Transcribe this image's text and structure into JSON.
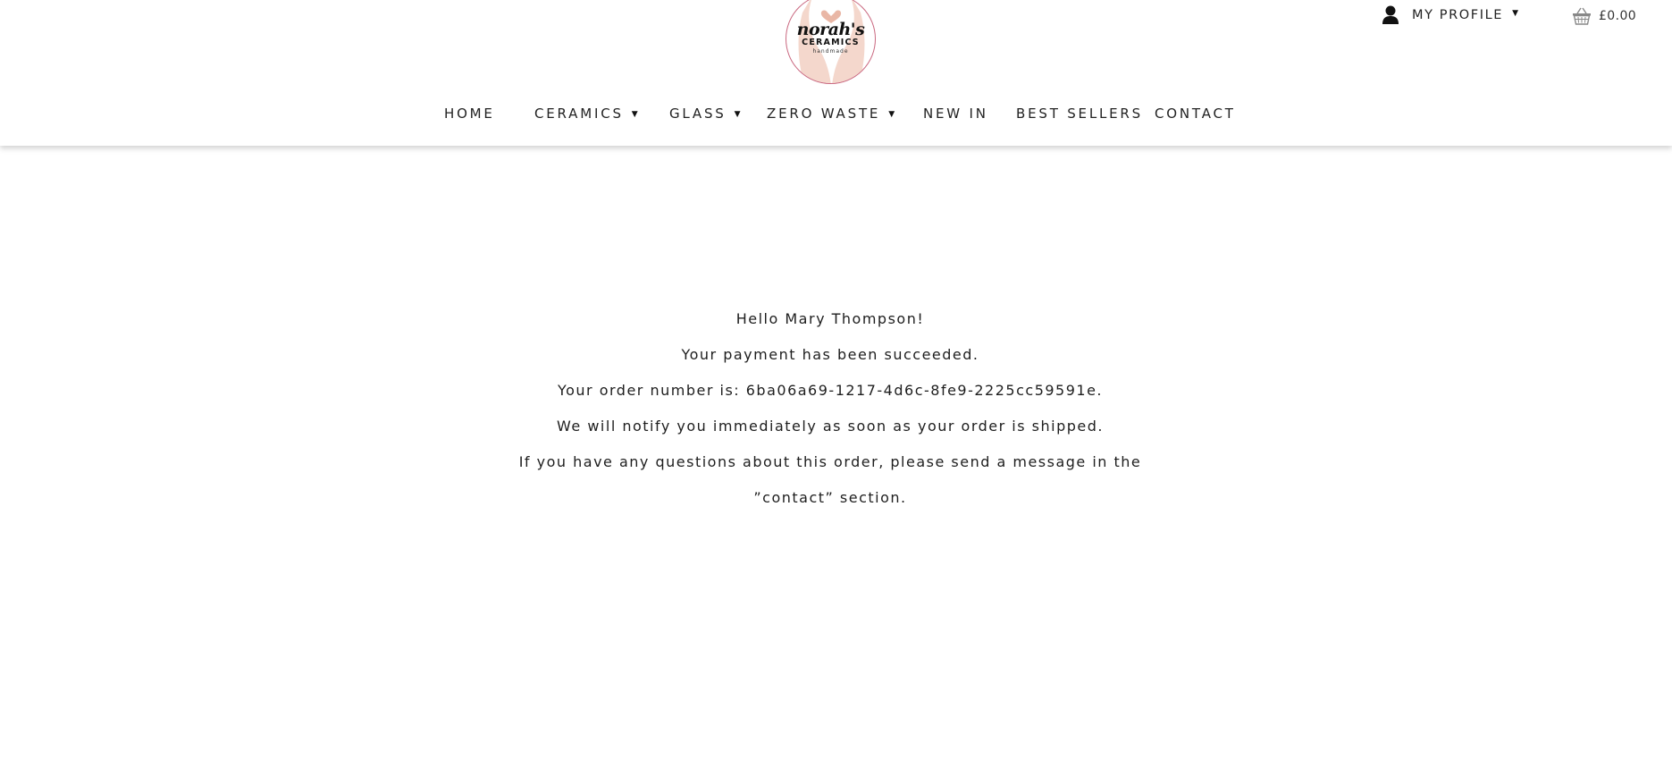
{
  "brand": {
    "logo_script": "norah's",
    "logo_caps": "CERAMICS",
    "logo_small": "handmade",
    "accent_color": "#c9677f",
    "logo_blush_color": "#f3d3c6"
  },
  "header": {
    "profile_label": "MY PROFILE",
    "profile_icon": "person-icon",
    "cart_icon": "basket-icon",
    "cart_total": "£0.00"
  },
  "nav": {
    "items": [
      {
        "label": "HOME",
        "has_dropdown": false
      },
      {
        "label": "CERAMICS",
        "has_dropdown": true
      },
      {
        "label": "GLASS",
        "has_dropdown": true
      },
      {
        "label": "ZERO WASTE",
        "has_dropdown": true
      },
      {
        "label": "NEW IN",
        "has_dropdown": false
      },
      {
        "label": "BEST SELLERS",
        "has_dropdown": false
      },
      {
        "label": "CONTACT",
        "has_dropdown": false
      }
    ],
    "dropdown_glyph": "▼"
  },
  "confirmation": {
    "greeting": "Hello Mary Thompson!",
    "status": "Your payment has been succeeded.",
    "order_number": "Your order number is: 6ba06a69-1217-4d6c-8fe9-2225cc59591e.",
    "notify": "We will notify you immediately as soon as your order is shipped.",
    "questions": "If you have any questions about this order, please send a message in the ”contact” section."
  }
}
